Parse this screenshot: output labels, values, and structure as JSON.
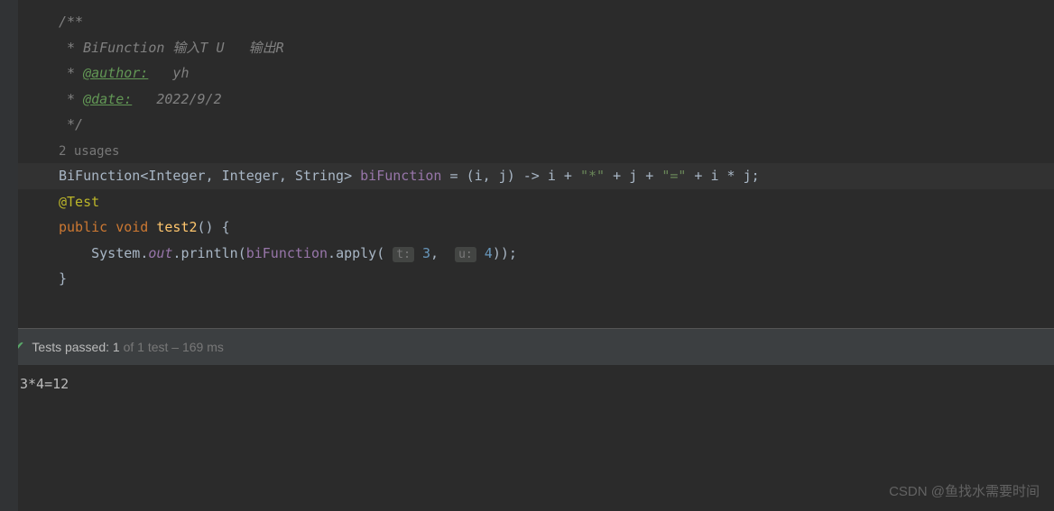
{
  "code": {
    "comment_start": "/**",
    "comment_desc": " * BiFunction 输入T U   输出R",
    "comment_author_tag": "@author:",
    "comment_author_val": "   yh",
    "comment_date_tag": "@date:",
    "comment_date_val": "   2022/9/2",
    "comment_end": " */",
    "usages": "2 usages",
    "decl_type": "BiFunction",
    "decl_g1": "Integer",
    "decl_g2": "Integer",
    "decl_g3": "String",
    "decl_name": "biFunction",
    "lambda_params": "(i, j)",
    "lambda_arrow": " -> ",
    "lambda_body_i": "i",
    "lambda_str1": "\"*\"",
    "lambda_body_j": "j",
    "lambda_str2": "\"=\"",
    "lambda_tail": "i * j",
    "annotation": "@Test",
    "kw_public": "public",
    "kw_void": "void",
    "method_name": "test2",
    "sys": "System",
    "out": "out",
    "println": "println",
    "apply": "apply",
    "hint_t": "t:",
    "arg_t": "3",
    "hint_u": "u:",
    "arg_u": "4",
    "brace_close": "}"
  },
  "tests": {
    "passed_label": "Tests passed:",
    "passed_count": "1",
    "of_text": "of 1 test – 169 ms"
  },
  "console": {
    "output": "3*4=12"
  },
  "watermark": "CSDN @鱼找水需要时间"
}
